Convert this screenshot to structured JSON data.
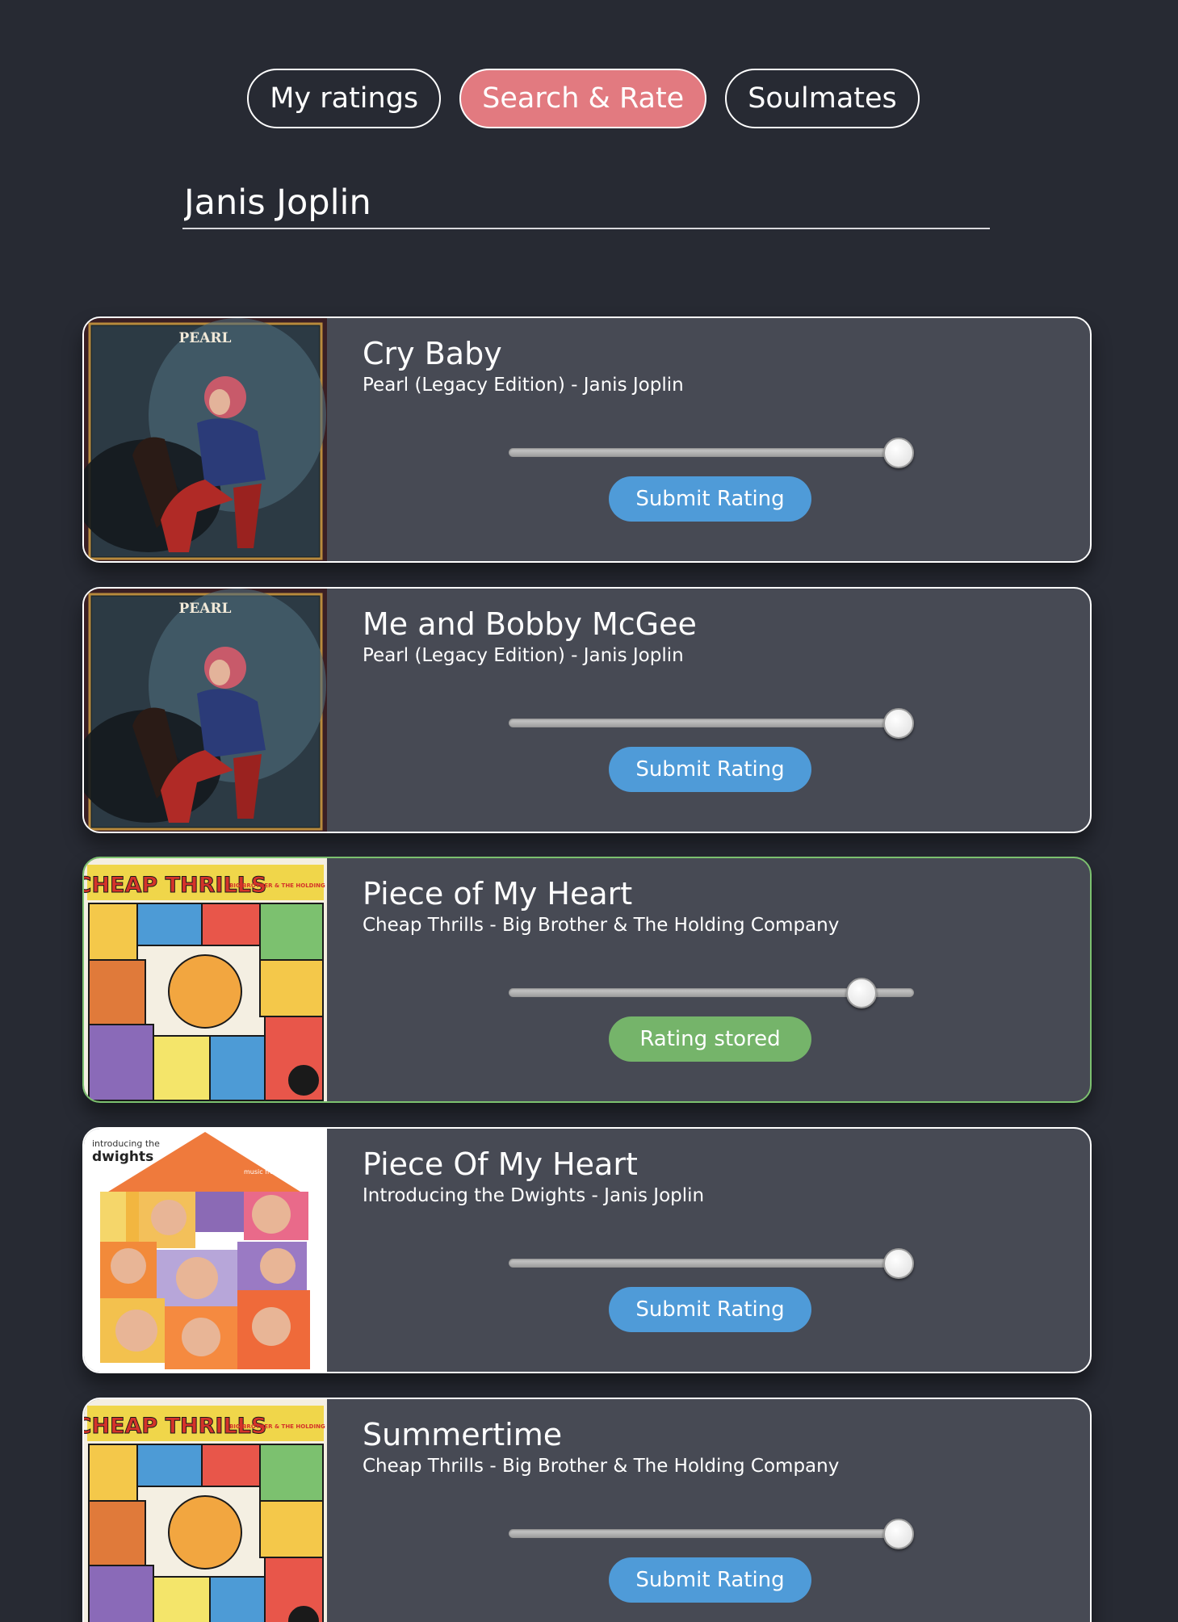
{
  "tabs": [
    {
      "label": "My ratings",
      "active": false
    },
    {
      "label": "Search & Rate",
      "active": true
    },
    {
      "label": "Soulmates",
      "active": false
    }
  ],
  "search": {
    "value": "Janis Joplin"
  },
  "cover_texts": {
    "pearl": "PEARL",
    "cheap_thrills": "CHEAP THRILLS",
    "big_brother": "BIG BROTHER & THE HOLDING COMPANY",
    "dwights_intro": "introducing the",
    "dwights_title": "dwights",
    "dwights_tag": "music from the motion picture"
  },
  "results": [
    {
      "title": "Cry Baby",
      "subtitle": "Pearl (Legacy Edition) - Janis Joplin",
      "cover": "pearl",
      "rating": 1.0,
      "button": "Submit Rating",
      "state": "submit"
    },
    {
      "title": "Me and Bobby McGee",
      "subtitle": "Pearl (Legacy Edition) - Janis Joplin",
      "cover": "pearl",
      "rating": 1.0,
      "button": "Submit Rating",
      "state": "submit"
    },
    {
      "title": "Piece of My Heart",
      "subtitle": "Cheap Thrills - Big Brother & The Holding Company",
      "cover": "cheap-thrills",
      "rating": 0.9,
      "button": "Rating stored",
      "state": "stored"
    },
    {
      "title": "Piece Of My Heart",
      "subtitle": "Introducing the Dwights - Janis Joplin",
      "cover": "dwights",
      "rating": 1.0,
      "button": "Submit Rating",
      "state": "submit"
    },
    {
      "title": "Summertime",
      "subtitle": "Cheap Thrills - Big Brother & The Holding Company",
      "cover": "cheap-thrills",
      "rating": 1.0,
      "button": "Submit Rating",
      "state": "submit"
    }
  ],
  "colors": {
    "background": "#272a33",
    "card": "#474a54",
    "active_tab": "#e27a80",
    "submit_button": "#4f9bd8",
    "stored_button": "#75b46a",
    "stored_border": "#7cc16f"
  }
}
